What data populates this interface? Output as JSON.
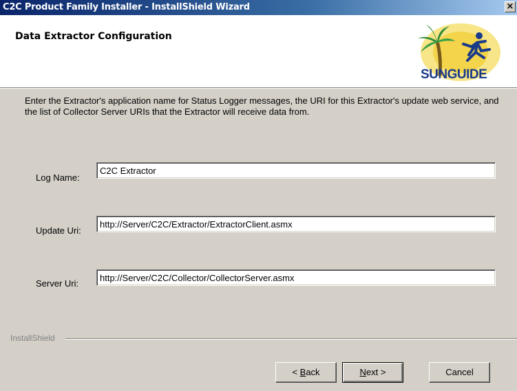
{
  "window": {
    "title": "C2C Product Family Installer - InstallShield Wizard",
    "close_glyph": "×"
  },
  "header": {
    "title": "Data Extractor Configuration",
    "logo_text": "SUNGUIDE",
    "logo_icon": "palm-tree-runner-logo"
  },
  "description": "Enter the Extractor's application name for Status Logger messages, the URI for this Extractor's update web service, and the list of Collector Server URIs that the Extractor will receive data from.",
  "fields": {
    "log_name": {
      "label": "Log Name:",
      "value": "C2C Extractor"
    },
    "update_uri": {
      "label": "Update Uri:",
      "value": "http://Server/C2C/Extractor/ExtractorClient.asmx"
    },
    "server_uri": {
      "label": "Server Uri:",
      "value": "http://Server/C2C/Collector/CollectorServer.asmx"
    }
  },
  "footer": {
    "brand": "InstallShield",
    "back_prefix": "< ",
    "back_mnemonic": "B",
    "back_rest": "ack",
    "next_mnemonic": "N",
    "next_rest": "ext >",
    "cancel": "Cancel"
  }
}
